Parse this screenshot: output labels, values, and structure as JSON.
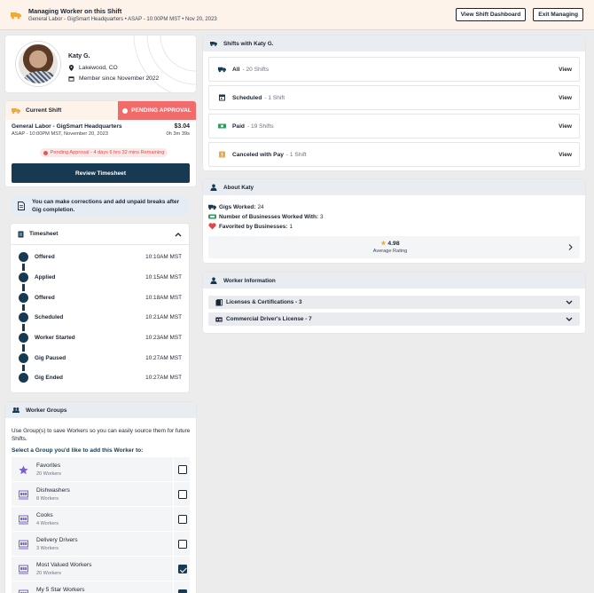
{
  "banner": {
    "title": "Managing Worker on this Shift",
    "subtitle": "General Labor - GigSmart Headquarters • ASAP - 10:00PM MST • Nov 20, 2023",
    "dashboard_button": "View Shift Dashboard",
    "exit_button": "Exit Managing"
  },
  "profile": {
    "name": "Katy G.",
    "location": "Lakewood, CO",
    "member_since": "Member since November 2022"
  },
  "current_shift": {
    "header": "Current Shift",
    "status": "PENDING APPROVAL",
    "title": "General Labor - GigSmart Headquarters",
    "subtitle": "ASAP - 10:00PM MST, November 20, 2023",
    "amount": "$3.04",
    "duration": "0h 3m 39s",
    "pending_note": "Pending Approval - 4 days 6 hrs 32 mins Remaining",
    "review_button": "Review Timesheet"
  },
  "notice": {
    "text": "You can make corrections and add unpaid breaks after Gig completion."
  },
  "timesheet": {
    "header": "Timesheet",
    "entries": [
      {
        "label": "Offered",
        "time": "10:10AM MST"
      },
      {
        "label": "Applied",
        "time": "10:15AM MST"
      },
      {
        "label": "Offered",
        "time": "10:18AM MST"
      },
      {
        "label": "Scheduled",
        "time": "10:21AM MST"
      },
      {
        "label": "Worker Started",
        "time": "10:23AM MST"
      },
      {
        "label": "Gig Paused",
        "time": "10:27AM MST"
      },
      {
        "label": "Gig Ended",
        "time": "10:27AM MST"
      }
    ]
  },
  "groups": {
    "header": "Worker Groups",
    "description": "Use Group(s) to save Workers so you can easily source them for future Shifts.",
    "select_label": "Select a Group you'd like to add this Worker to:",
    "items": [
      {
        "name": "Favorites",
        "count": "20 Workers",
        "checked": false,
        "icon": "star-icon"
      },
      {
        "name": "Dishwashers",
        "count": "8 Workers",
        "checked": false,
        "icon": "group-icon"
      },
      {
        "name": "Cooks",
        "count": "4 Workers",
        "checked": false,
        "icon": "group-icon"
      },
      {
        "name": "Delivery Drivers",
        "count": "3 Workers",
        "checked": false,
        "icon": "group-icon"
      },
      {
        "name": "Most Valued Workers",
        "count": "20 Workers",
        "checked": true,
        "icon": "group-icon"
      },
      {
        "name": "My 5 Star Workers",
        "count": "",
        "checked": true,
        "icon": "group-icon"
      }
    ]
  },
  "shifts_with": {
    "header": "Shifts with Katy G.",
    "view_label": "View",
    "rows": [
      {
        "name": "All",
        "count": "- 20 Shifts",
        "icon": "truck-icon"
      },
      {
        "name": "Scheduled",
        "count": "- 1 Shift",
        "icon": "calendar-icon"
      },
      {
        "name": "Paid",
        "count": "- 19 Shifts",
        "icon": "money-icon"
      },
      {
        "name": "Canceled with Pay",
        "count": "- 1 Shift",
        "icon": "cancel-icon"
      }
    ]
  },
  "about": {
    "header": "About Katy",
    "gigs_label": "Gigs Worked:",
    "gigs_value": "24",
    "businesses_label": "Number of Businesses Worked With:",
    "businesses_value": "3",
    "favorited_label": "Favorited by Businesses:",
    "favorited_value": "1",
    "rating_value": "4.98",
    "rating_label": "Average Rating"
  },
  "worker_info": {
    "header": "Worker Information",
    "licenses": "Licenses & Certifications - 3",
    "drivers": "Commercial Driver's License - 7"
  },
  "colors": {
    "navy": "#173a52",
    "accent_orange": "#f0a93a",
    "pending_red": "#f26b6b",
    "purple": "#7b62c9"
  }
}
